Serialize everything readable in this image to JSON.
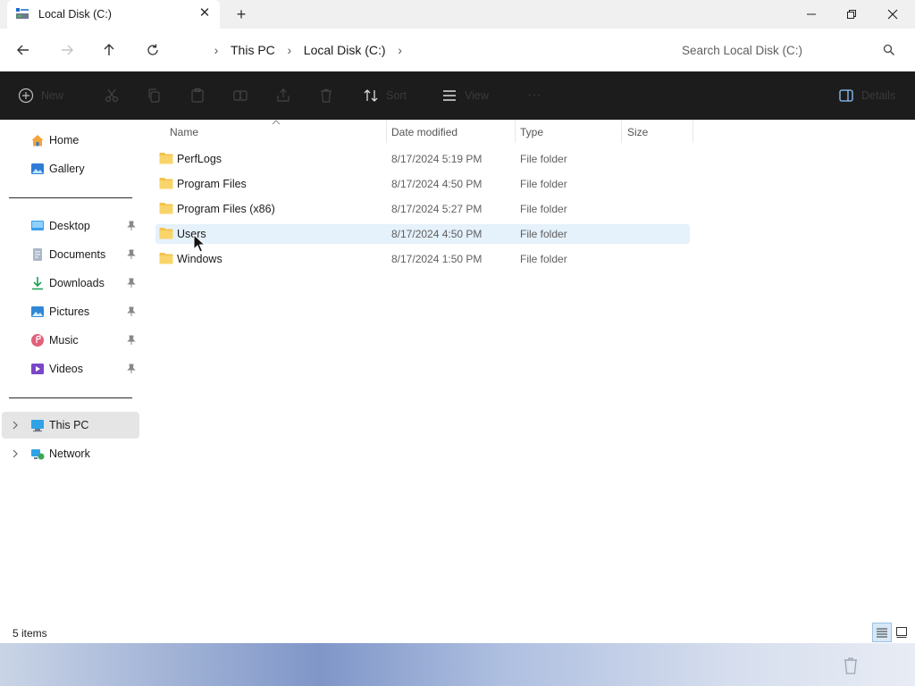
{
  "window": {
    "tab_title": "Local Disk (C:)",
    "new_tab": "+"
  },
  "nav": {
    "breadcrumbs": [
      "This PC",
      "Local Disk (C:)"
    ],
    "search_placeholder": "Search Local Disk (C:)"
  },
  "commands": {
    "new": "New",
    "sort": "Sort",
    "view": "View",
    "more": "···",
    "details": "Details"
  },
  "sidebar": {
    "quick": [
      {
        "label": "Home",
        "icon": "home-icon"
      },
      {
        "label": "Gallery",
        "icon": "gallery-icon"
      }
    ],
    "pinned": [
      {
        "label": "Desktop",
        "icon": "desktop-icon"
      },
      {
        "label": "Documents",
        "icon": "documents-icon"
      },
      {
        "label": "Downloads",
        "icon": "downloads-icon"
      },
      {
        "label": "Pictures",
        "icon": "pictures-icon"
      },
      {
        "label": "Music",
        "icon": "music-icon"
      },
      {
        "label": "Videos",
        "icon": "videos-icon"
      }
    ],
    "locations": [
      {
        "label": "This PC",
        "icon": "this-pc-icon",
        "selected": true
      },
      {
        "label": "Network",
        "icon": "network-icon",
        "selected": false
      }
    ]
  },
  "columns": [
    "Name",
    "Date modified",
    "Type",
    "Size"
  ],
  "files": [
    {
      "name": "PerfLogs",
      "date": "8/17/2024 5:19 PM",
      "type": "File folder",
      "size": ""
    },
    {
      "name": "Program Files",
      "date": "8/17/2024 4:50 PM",
      "type": "File folder",
      "size": ""
    },
    {
      "name": "Program Files (x86)",
      "date": "8/17/2024 5:27 PM",
      "type": "File folder",
      "size": ""
    },
    {
      "name": "Users",
      "date": "8/17/2024 4:50 PM",
      "type": "File folder",
      "size": "",
      "selected": true
    },
    {
      "name": "Windows",
      "date": "8/17/2024 1:50 PM",
      "type": "File folder",
      "size": ""
    }
  ],
  "status": {
    "items_count": "5 items"
  },
  "colors": {
    "command_bar": "#1c1c1c",
    "selection": "#e5f1fb",
    "folder": "#f3c24a"
  }
}
